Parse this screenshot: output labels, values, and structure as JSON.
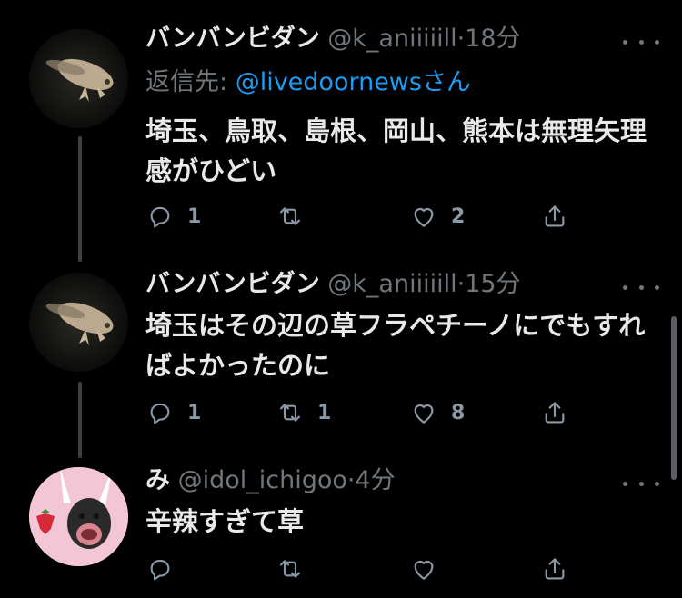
{
  "tweets": [
    {
      "name": "バンバンビダン",
      "handle": "@k_aniiiiill",
      "dot": "·",
      "time": "18分",
      "reply_prefix": "返信先: ",
      "reply_mention": "@livedoornewsさん",
      "text": "埼玉、鳥取、島根、岡山、熊本は無理矢理感がひどい",
      "reply_count": "1",
      "retweet_count": "",
      "like_count": "2"
    },
    {
      "name": "バンバンビダン",
      "handle": "@k_aniiiiill",
      "dot": "·",
      "time": "15分",
      "text": "埼玉はその辺の草フラペチーノにでもすればよかったのに",
      "reply_count": "1",
      "retweet_count": "1",
      "like_count": "8"
    },
    {
      "name": "み",
      "handle": "@idol_ichigoo",
      "dot": "·",
      "time": "4分",
      "text": "辛辣すぎて草",
      "reply_count": "",
      "retweet_count": "",
      "like_count": ""
    }
  ],
  "colors": {
    "background": "#000000",
    "text": "#e7e9ea",
    "muted": "#71767b",
    "link": "#1d9bf0",
    "avatar_pink": "#f3c6d6"
  },
  "icons": [
    "reply-icon",
    "retweet-icon",
    "like-icon",
    "share-icon",
    "more-icon"
  ]
}
